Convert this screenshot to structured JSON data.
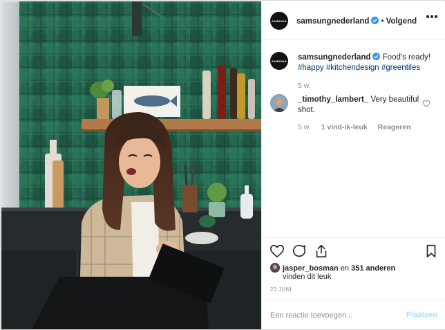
{
  "post": {
    "account": "samsungnederland",
    "avatar_text": "SAMSUNG",
    "follow_separator": "•",
    "follow_label": "Volgend",
    "more_icon": "more-options-icon"
  },
  "caption": {
    "username": "samsungnederland",
    "text": "Food's ready!",
    "hashtags": [
      "#happy",
      "#kitchendesign",
      "#greentiles"
    ],
    "age": "5 w."
  },
  "comments": [
    {
      "username": "_timothy_lambert_",
      "text": "Very beautiful shot.",
      "age": "5 w.",
      "likes": "1 vind-ik-leuk",
      "reply": "Reageren"
    }
  ],
  "likes": {
    "user": "jasper_bosman",
    "connector": "en",
    "others": "351 anderen",
    "suffix": "vinden dit leuk"
  },
  "date": "23 JUNI",
  "comment_box": {
    "placeholder": "Een reactie toevoegen...",
    "post_label": "Plaatsen"
  },
  "colors": {
    "verified": "#3897f0",
    "hashtag": "#003569",
    "post_disabled": "#b2dffc",
    "tile_green": "#1f5a48"
  }
}
